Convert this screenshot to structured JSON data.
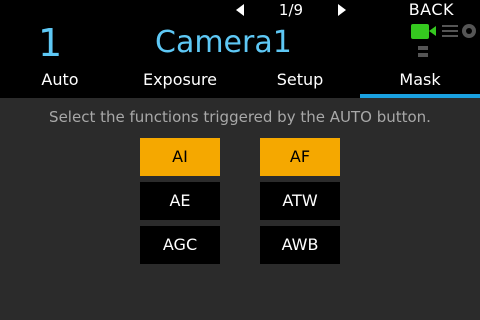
{
  "topbar": {
    "page": "1/9",
    "back_label": "BACK"
  },
  "header": {
    "camera_number": "1",
    "camera_name": "Camera1",
    "status_icons": [
      "video-camera-icon",
      "lens-icon",
      "fan-icon",
      "signal-icon"
    ],
    "accent_color": "#5ec8f5",
    "camera_icon_color": "#35c81f"
  },
  "tabs": [
    {
      "label": "Auto",
      "active": false
    },
    {
      "label": "Exposure",
      "active": false
    },
    {
      "label": "Setup",
      "active": false
    },
    {
      "label": "Mask",
      "active": true
    }
  ],
  "main": {
    "instruction": "Select the functions triggered by the AUTO button.",
    "functions": [
      {
        "label": "AI",
        "selected": true
      },
      {
        "label": "AF",
        "selected": true
      },
      {
        "label": "AE",
        "selected": false
      },
      {
        "label": "ATW",
        "selected": false
      },
      {
        "label": "AGC",
        "selected": false
      },
      {
        "label": "AWB",
        "selected": false
      }
    ],
    "selected_color": "#f5a800"
  }
}
